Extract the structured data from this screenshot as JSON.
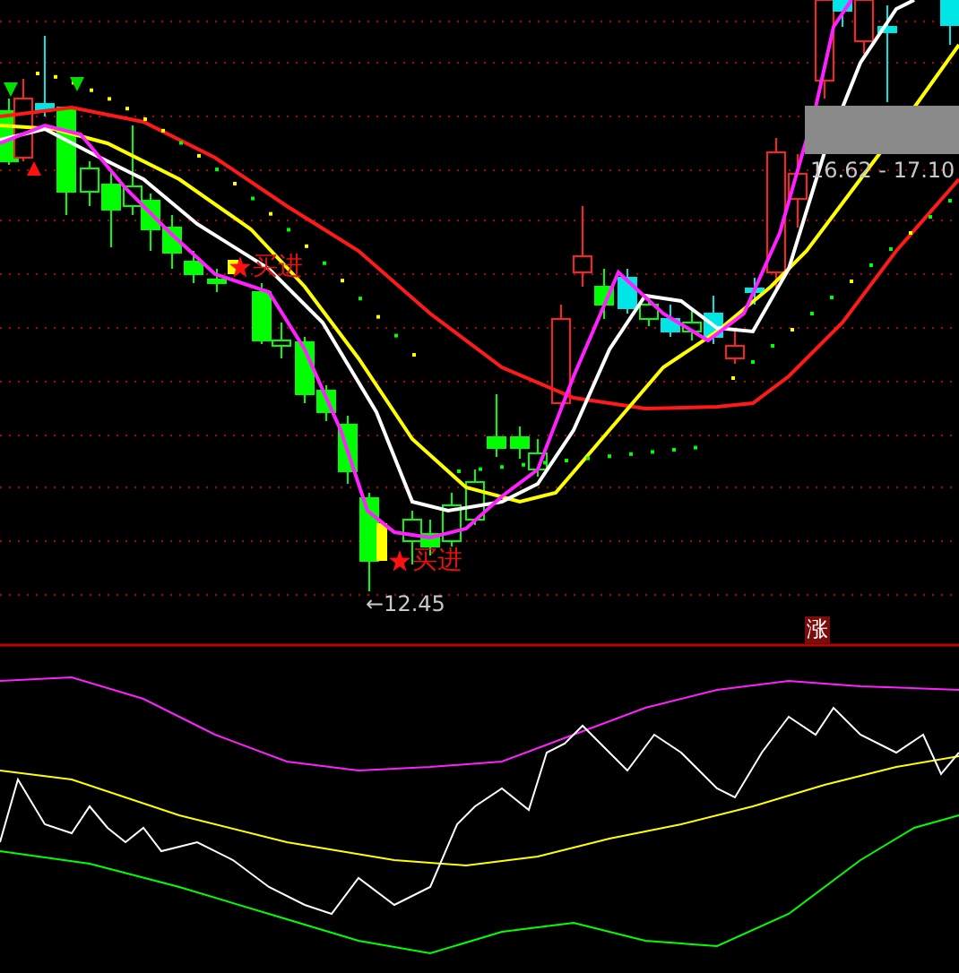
{
  "chart": {
    "signals": [
      {
        "label": "买进",
        "kind": "buy"
      },
      {
        "label": "买进",
        "kind": "buy"
      }
    ],
    "low_label": "←12.45",
    "range_label": "16.62 - 17.10",
    "badge": "涨"
  }
}
